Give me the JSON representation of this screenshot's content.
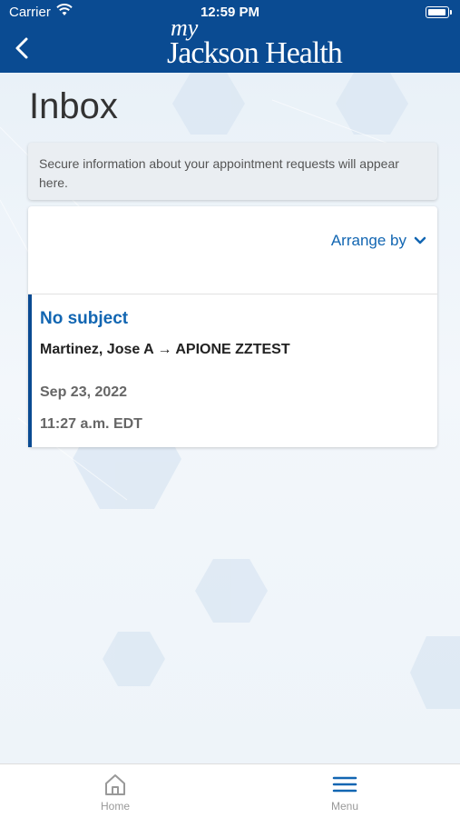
{
  "status_bar": {
    "carrier": "Carrier",
    "time": "12:59 PM"
  },
  "header": {
    "logo_my": "my",
    "logo_name": "Jackson Health",
    "back_icon": "chevron-left-icon"
  },
  "page": {
    "title": "Inbox",
    "notice": "Secure information about your appointment requests will appear here."
  },
  "toolbar": {
    "arrange_label": "Arrange by",
    "arrange_icon": "chevron-down-icon"
  },
  "messages": [
    {
      "subject": "No subject",
      "route": "Martinez, Jose A → APIONE ZZTEST",
      "date": "Sep 23, 2022",
      "time": "11:27 a.m. EDT"
    }
  ],
  "tabbar": {
    "home_label": "Home",
    "menu_label": "Menu"
  },
  "colors": {
    "brand": "#0a4b92",
    "link": "#1266b2"
  }
}
